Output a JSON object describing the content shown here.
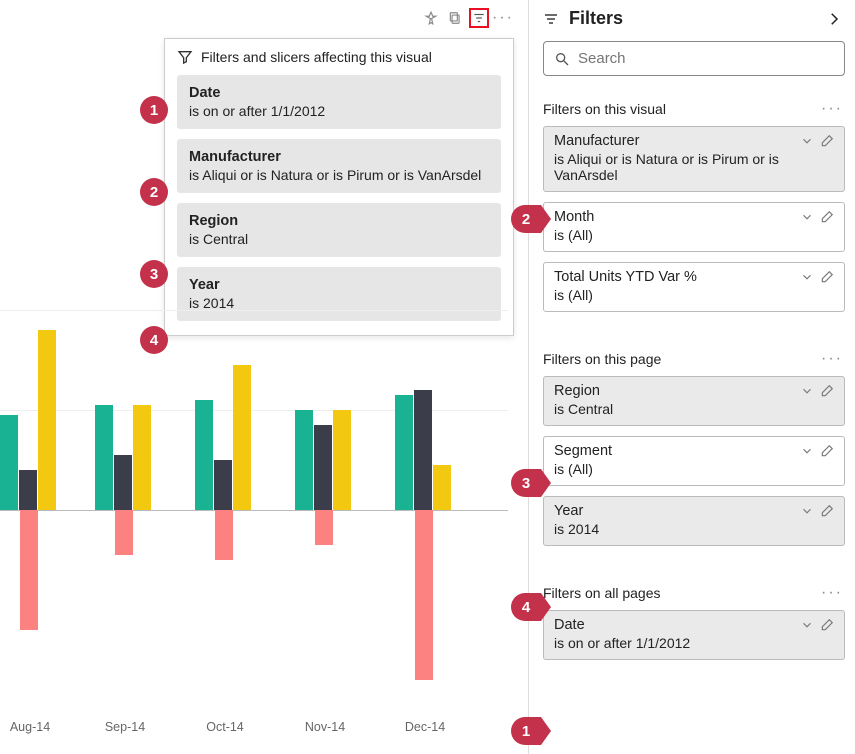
{
  "toolbar": {
    "pin": "pin-icon",
    "copy": "copy-icon",
    "filter": "filter-icon",
    "more": "more-icon"
  },
  "popup": {
    "title": "Filters and slicers affecting this visual",
    "items": [
      {
        "name": "Date",
        "value": "is on or after 1/1/2012"
      },
      {
        "name": "Manufacturer",
        "value": "is Aliqui or is Natura or is Pirum or is VanArsdel"
      },
      {
        "name": "Region",
        "value": "is Central"
      },
      {
        "name": "Year",
        "value": "is 2014"
      }
    ]
  },
  "badges": {
    "b1": "1",
    "b2": "2",
    "b3": "3",
    "b4": "4"
  },
  "pbadges": {
    "p1": "1",
    "p2": "2",
    "p3": "3",
    "p4": "4"
  },
  "filters_pane": {
    "title": "Filters",
    "search_placeholder": "Search",
    "sections": {
      "visual": {
        "title": "Filters on this visual",
        "items": [
          {
            "name": "Manufacturer",
            "value": "is Aliqui or is Natura or is Pirum or is VanArsdel",
            "active": true
          },
          {
            "name": "Month",
            "value": "is (All)",
            "active": false
          },
          {
            "name": "Total Units YTD Var %",
            "value": "is (All)",
            "active": false
          }
        ]
      },
      "page": {
        "title": "Filters on this page",
        "items": [
          {
            "name": "Region",
            "value": "is Central",
            "active": true
          },
          {
            "name": "Segment",
            "value": "is (All)",
            "active": false
          },
          {
            "name": "Year",
            "value": "is 2014",
            "active": true
          }
        ]
      },
      "allpages": {
        "title": "Filters on all pages",
        "items": [
          {
            "name": "Date",
            "value": "is on or after 1/1/2012",
            "active": true
          }
        ]
      }
    }
  },
  "chart_data": {
    "type": "bar",
    "categories": [
      "Aug-14",
      "Sep-14",
      "Oct-14",
      "Nov-14",
      "Dec-14"
    ],
    "series": [
      {
        "name": "Teal",
        "color": "#19B394",
        "values": [
          95,
          105,
          110,
          100,
          115
        ]
      },
      {
        "name": "Dark",
        "color": "#3B3E4A",
        "values": [
          40,
          55,
          50,
          85,
          120
        ]
      },
      {
        "name": "Yellow",
        "color": "#F2C811",
        "values": [
          180,
          105,
          145,
          100,
          45
        ]
      },
      {
        "name": "Coral",
        "color": "#FB8281",
        "values": [
          -120,
          -45,
          -50,
          -35,
          -170
        ]
      }
    ],
    "baseline": 0,
    "title": "",
    "xlabel": "",
    "ylabel": ""
  }
}
